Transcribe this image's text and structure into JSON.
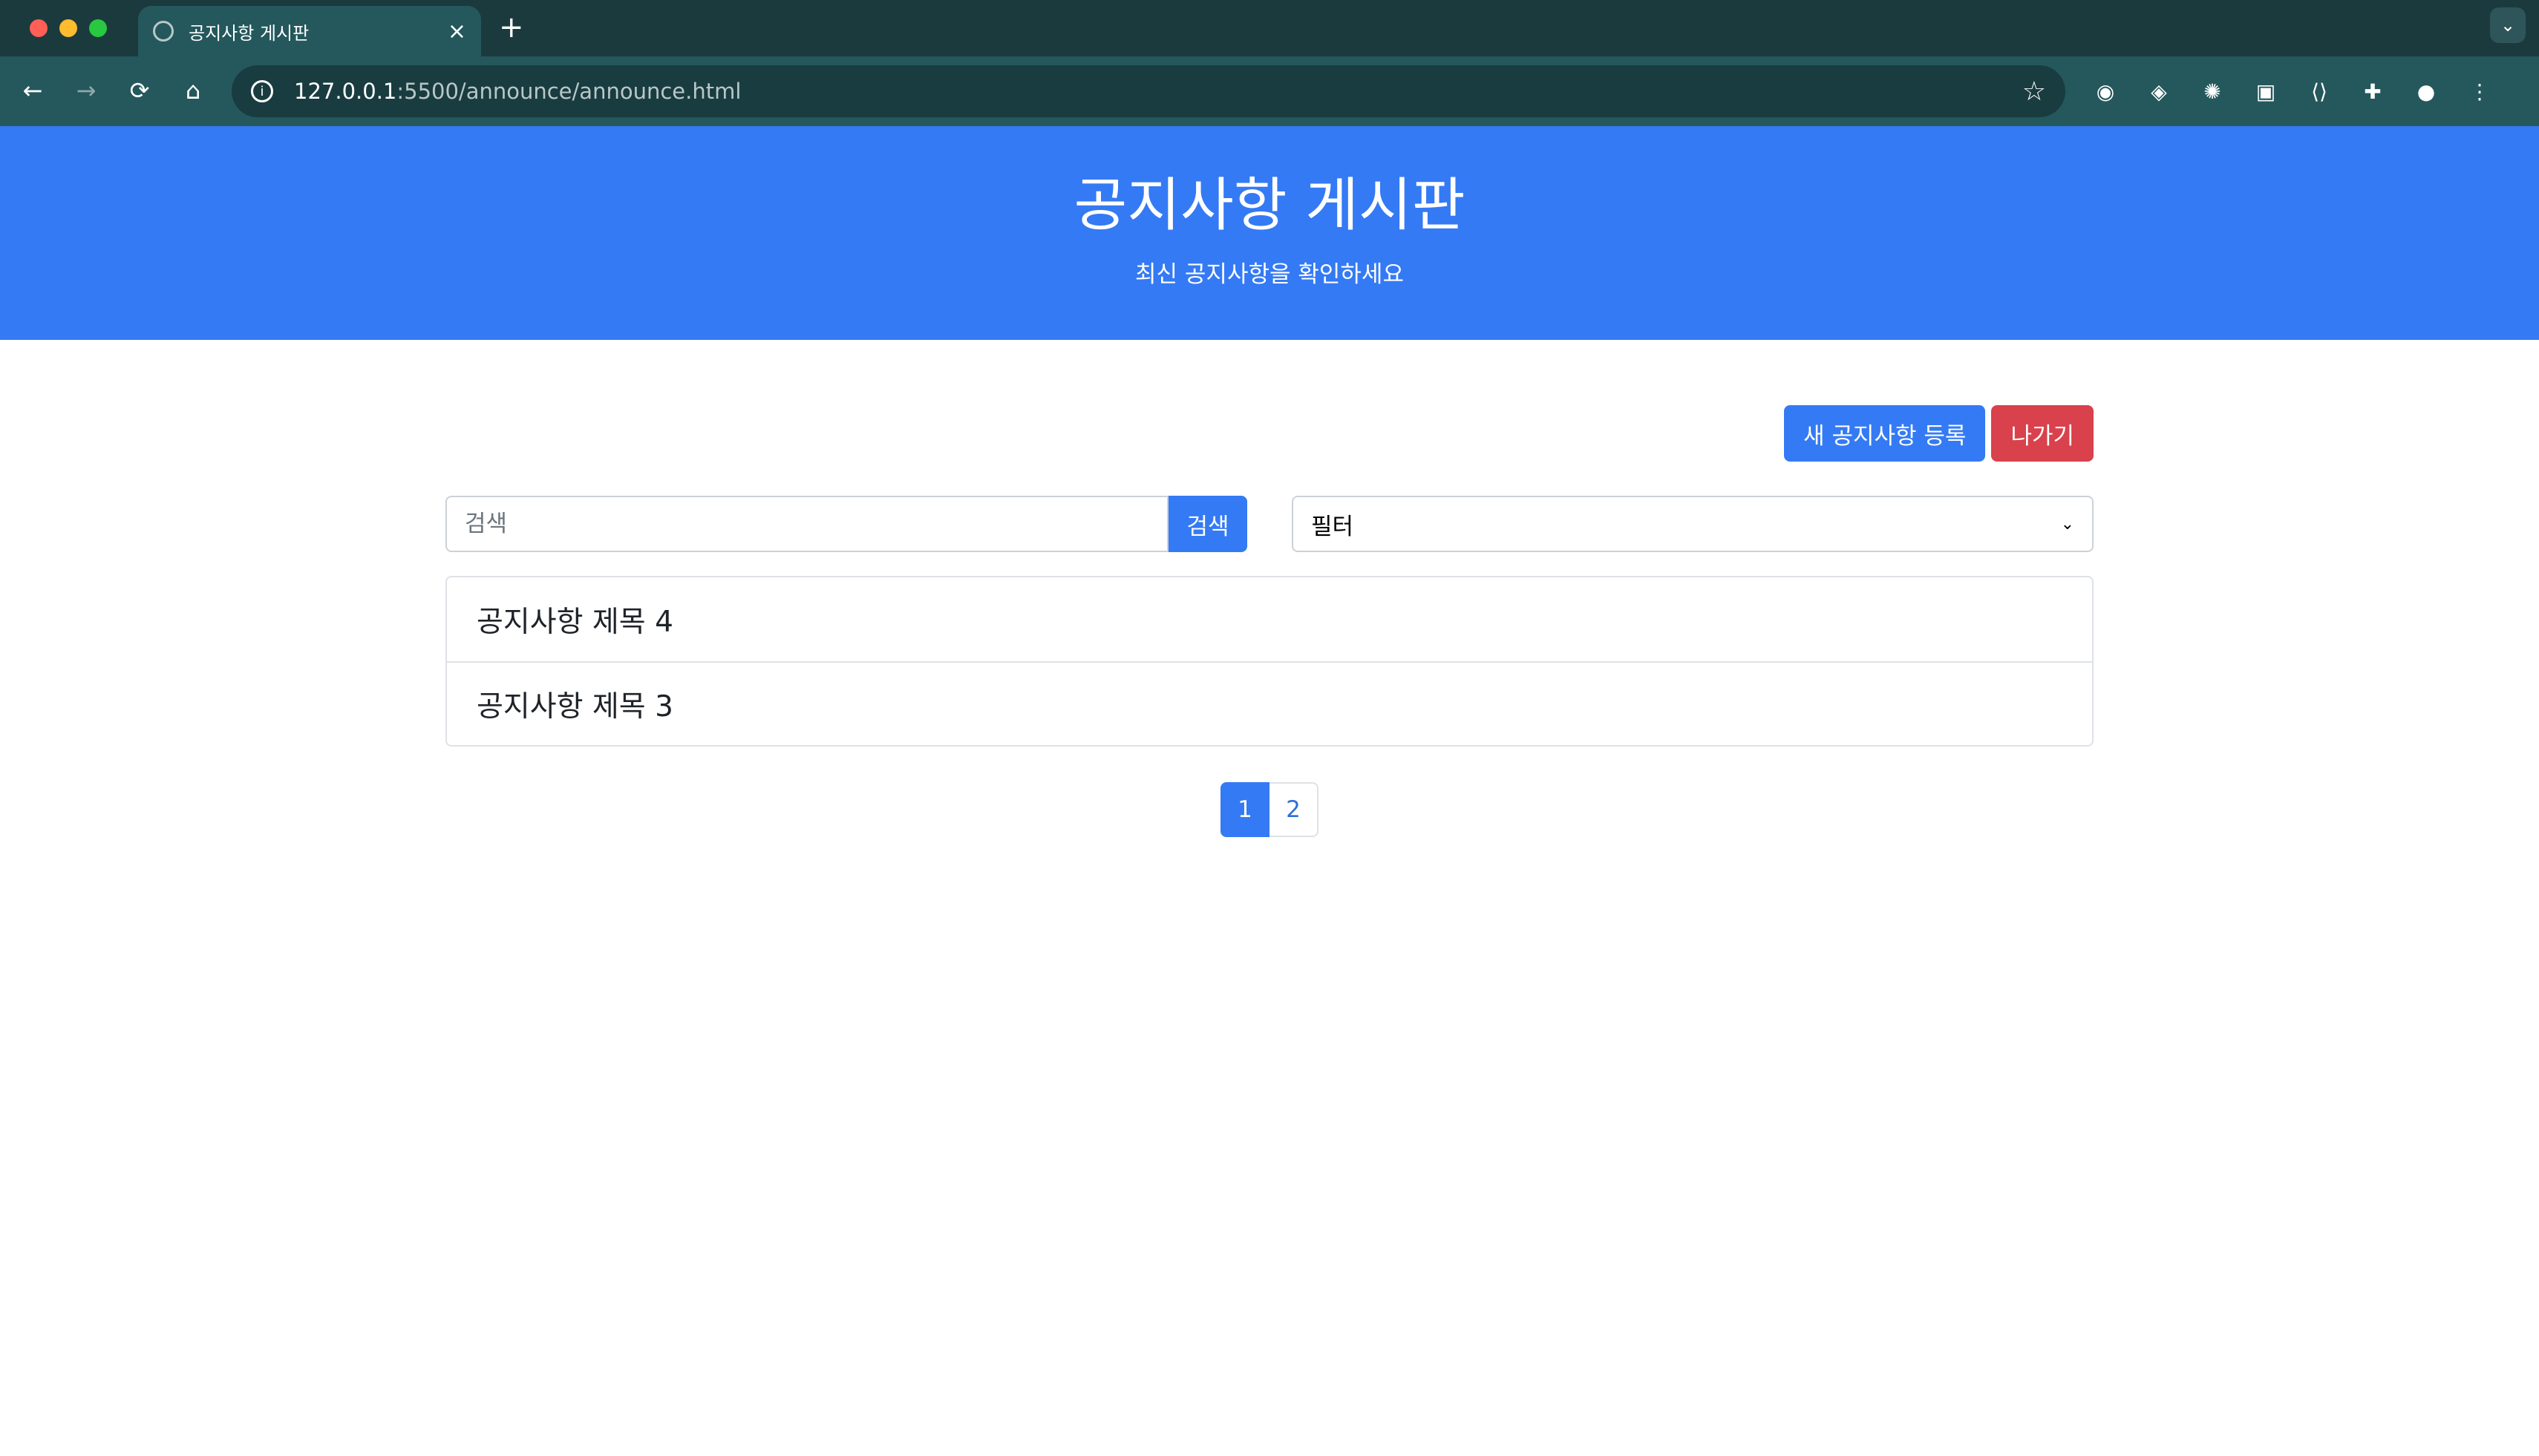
{
  "browser": {
    "tab_title": "공지사항 게시판",
    "url_host": "127.0.0.1",
    "url_path": ":5500/announce/announce.html",
    "colors": {
      "frame": "#1b3a3d",
      "toolbar": "#24585c"
    }
  },
  "header": {
    "title": "공지사항 게시판",
    "subtitle": "최신 공지사항을 확인하세요",
    "background": "#347af4"
  },
  "actions": {
    "new_label": "새 공지사항 등록",
    "exit_label": "나가기"
  },
  "search": {
    "placeholder": "검색",
    "button_label": "검색"
  },
  "filter": {
    "selected": "필터"
  },
  "notices": [
    {
      "title": "공지사항 제목 4"
    },
    {
      "title": "공지사항 제목 3"
    }
  ],
  "pagination": {
    "pages": [
      "1",
      "2"
    ],
    "active": "1"
  }
}
